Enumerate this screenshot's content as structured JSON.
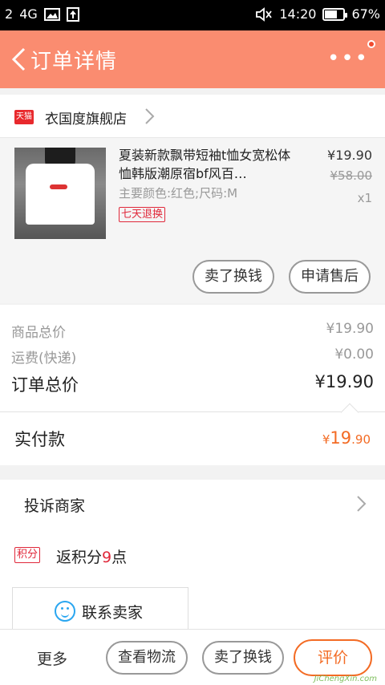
{
  "status_bar": {
    "sim": "2",
    "network": "4G",
    "time": "14:20",
    "battery": "67%",
    "battery_level": 0.67,
    "icons": [
      "sim-icon",
      "signal-icon",
      "gallery-icon",
      "upload-icon",
      "mute-icon",
      "battery-icon"
    ]
  },
  "header": {
    "title": "订单详情",
    "more_label": "•••",
    "back_icon": "chevron-left-icon",
    "accent": "#fa8c70"
  },
  "store": {
    "badge": "天猫",
    "name": "衣国度旗舰店"
  },
  "product": {
    "title": "夏装新款飘带短袖t恤女宽松体恤韩版潮原宿bf风百…",
    "sku": "主要颜色:红色;尺码:M",
    "tag": "七天退换",
    "price": "¥19.90",
    "original_price": "¥58.00",
    "quantity": "x1",
    "actions": [
      "卖了换钱",
      "申请售后"
    ]
  },
  "summary": {
    "goods_total_label": "商品总价",
    "goods_total": "¥19.90",
    "shipping_label": "运费(快递)",
    "shipping": "¥0.00",
    "order_total_label": "订单总价",
    "order_total": "¥19.90"
  },
  "payment": {
    "label": "实付款",
    "currency": "¥",
    "amount_main": "19",
    "amount_decimal": ".90",
    "color": "#f36b24"
  },
  "complain": {
    "label": "投诉商家"
  },
  "points": {
    "badge": "积分",
    "prefix": "返积分",
    "value": "9",
    "suffix": "点"
  },
  "contact": {
    "label": "联系卖家"
  },
  "bottom_bar": {
    "more": "更多",
    "logistics": "查看物流",
    "sell": "卖了换钱",
    "review": "评价"
  },
  "watermark": "JiChengXin.com"
}
